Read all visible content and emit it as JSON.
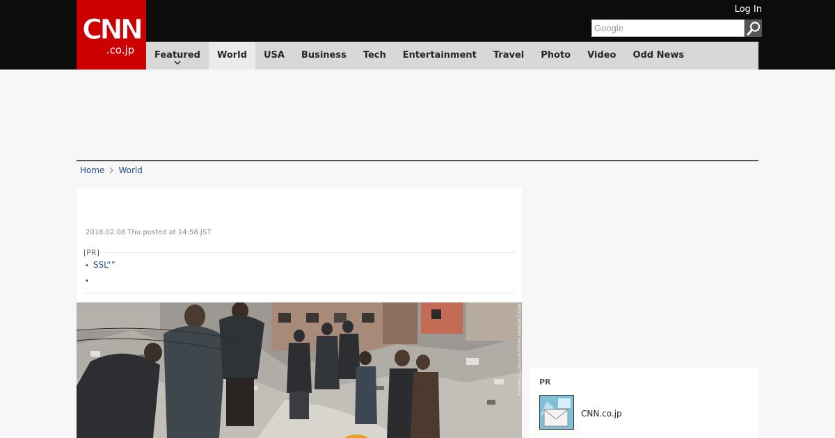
{
  "header": {
    "logo": {
      "main": "CNN",
      "sub": ".co.jp"
    },
    "login_label": "Log In",
    "search": {
      "placeholder": "Google",
      "value": "",
      "button_icon": "search-icon"
    },
    "colors": {
      "brand": "#cc0000",
      "topbar": "#0c0c0c",
      "nav": "#d8d8d8"
    }
  },
  "nav": {
    "items": [
      {
        "label": "Featured",
        "icon": "chevron-down-icon"
      },
      {
        "label": "World",
        "active": true
      },
      {
        "label": "USA"
      },
      {
        "label": "Business"
      },
      {
        "label": "Tech"
      },
      {
        "label": "Entertainment"
      },
      {
        "label": "Travel"
      },
      {
        "label": "Photo"
      },
      {
        "label": "Video"
      },
      {
        "label": "Odd News"
      }
    ]
  },
  "breadcrumb": {
    "items": [
      "Home",
      "World"
    ],
    "separator_icon": "chevron-right-icon"
  },
  "article": {
    "posted": "2018.02.08 Thu posted at 14:58 JST",
    "pr": {
      "label": "[PR]",
      "links": [
        "SSL“”",
        ""
      ]
    },
    "photo_credit": "ABDULMONAM EASSA/AFP/GETTY IMAGES"
  },
  "sidebar": {
    "pr": {
      "label": "PR",
      "item_text": "CNN.co.jp",
      "thumb_icon": "envelope-icon"
    }
  }
}
